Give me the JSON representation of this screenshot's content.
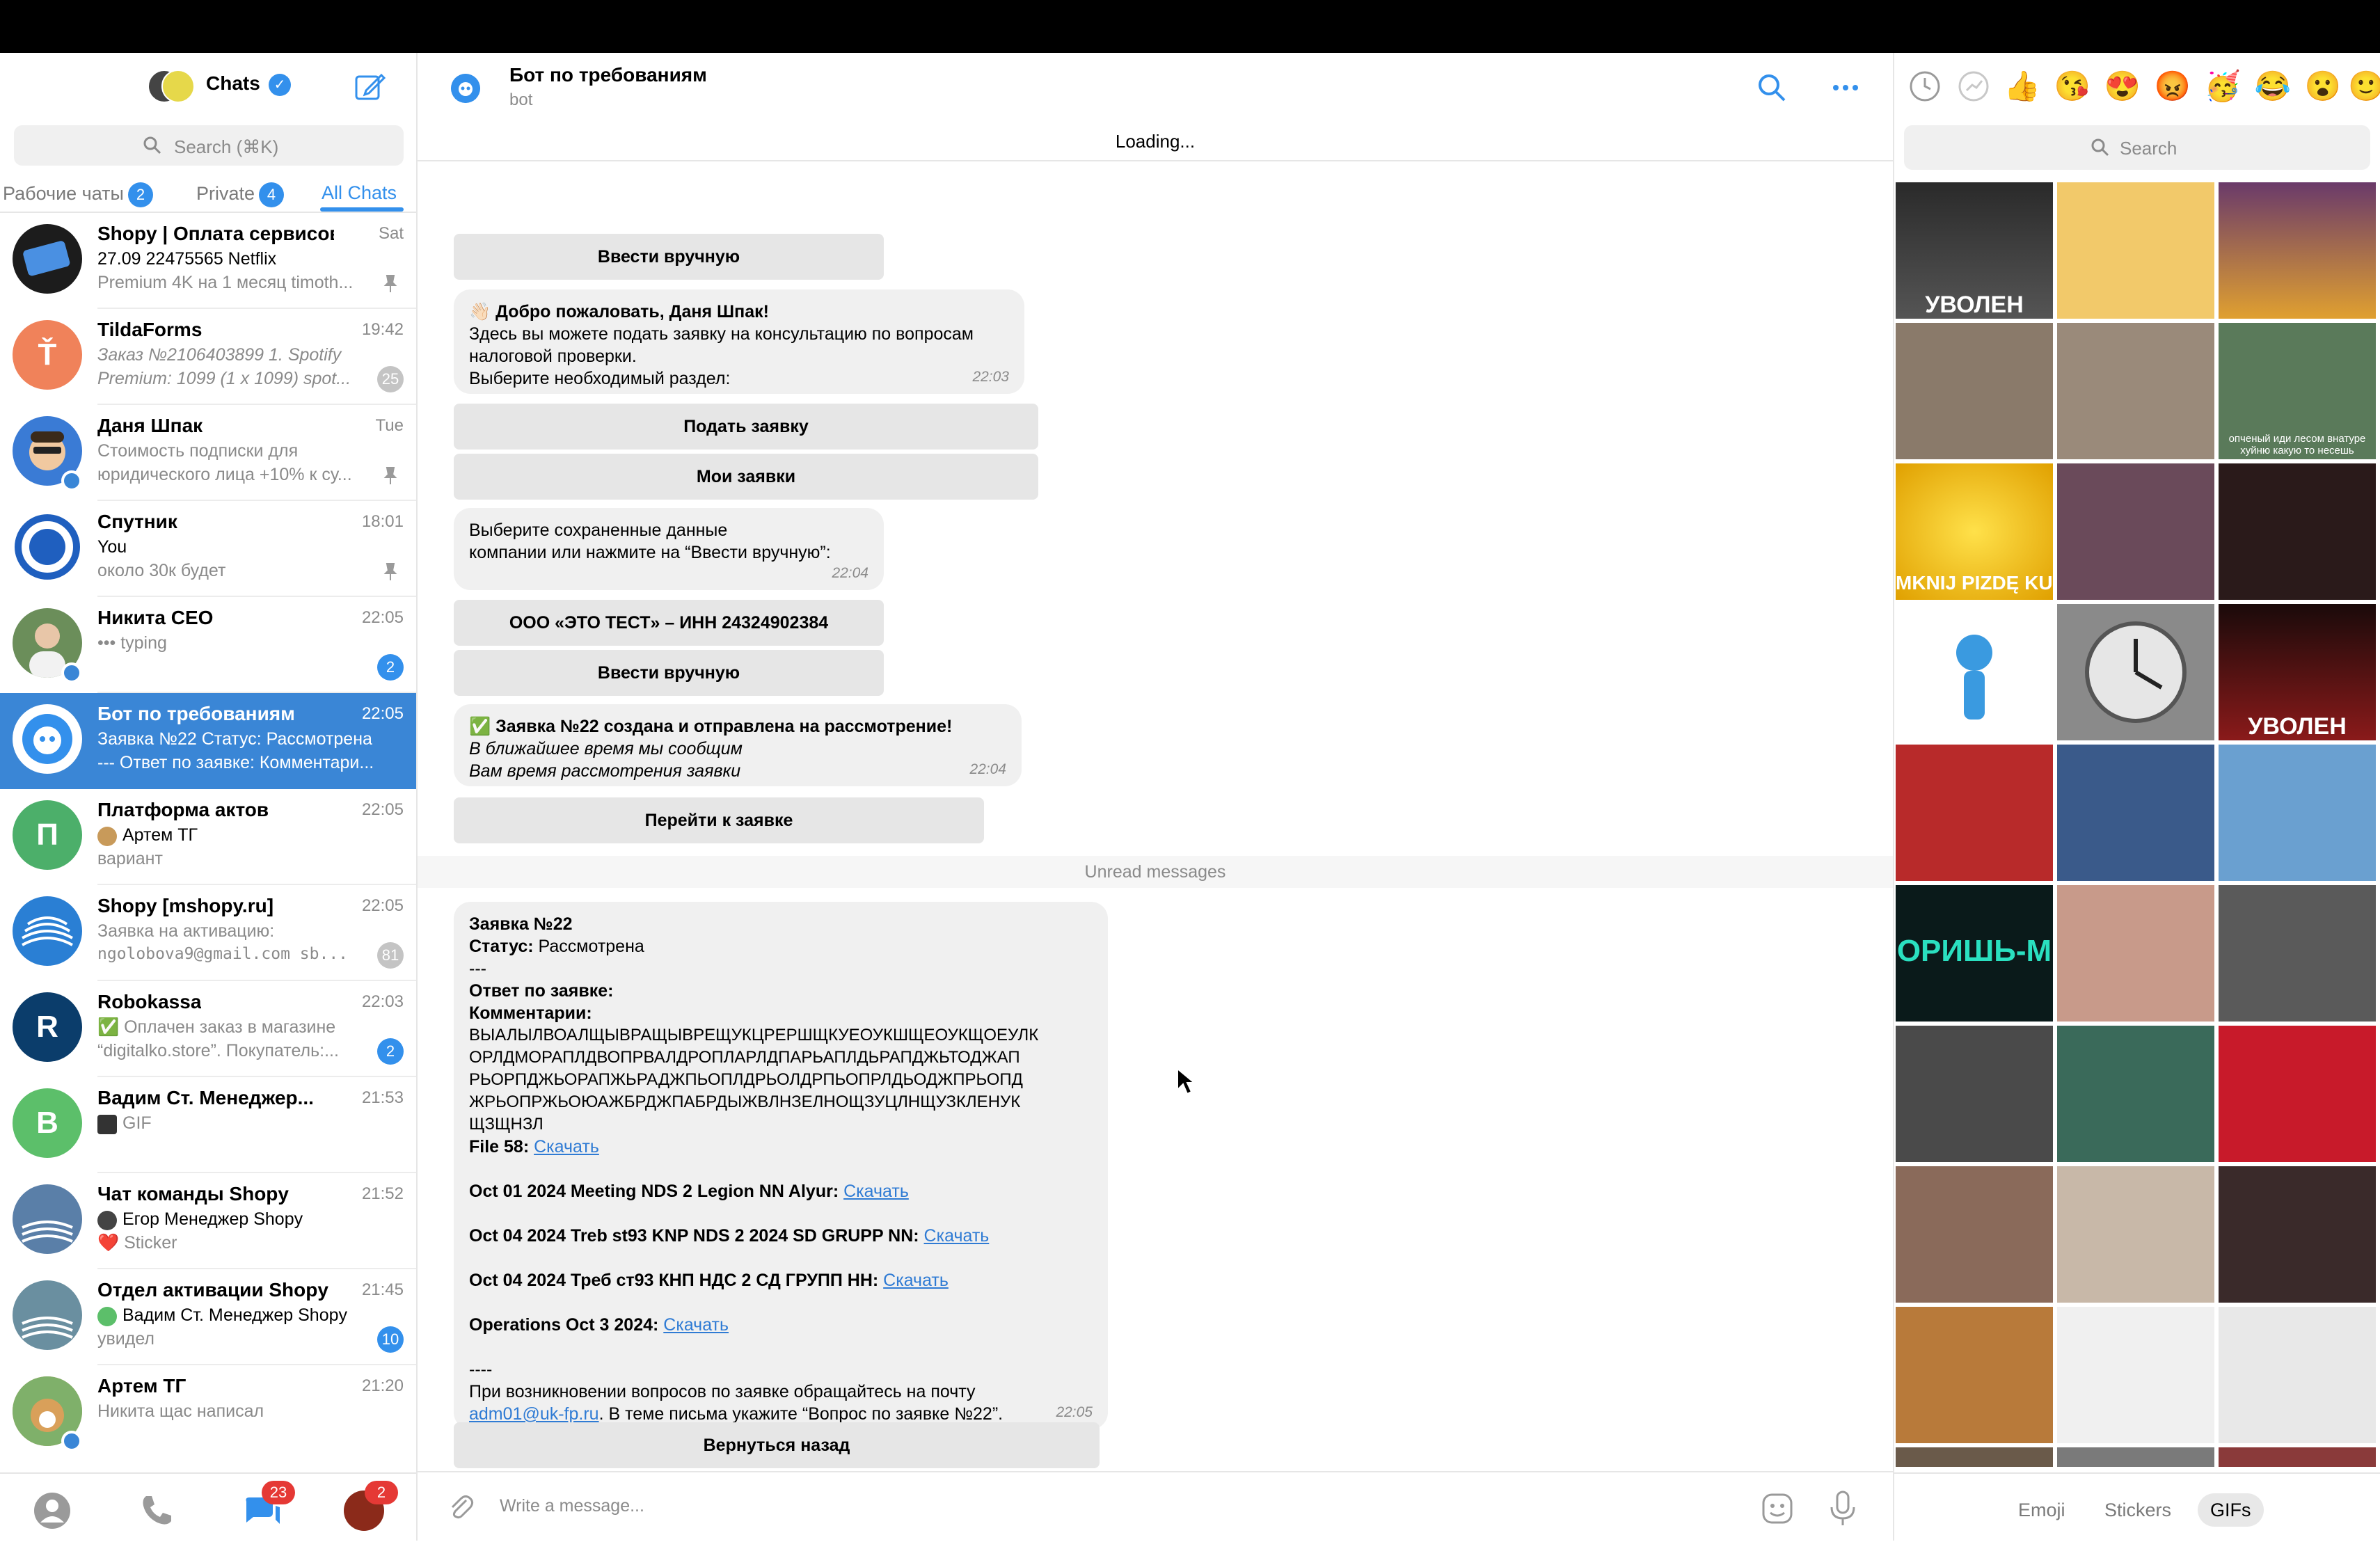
{
  "left": {
    "title": "Chats",
    "search_placeholder": "Search (⌘K)",
    "folders": [
      {
        "label": "Рабочие чаты",
        "badge": "2"
      },
      {
        "label": "Private",
        "badge": "4"
      },
      {
        "label": "All Chats",
        "badge": ""
      }
    ],
    "chats": [
      {
        "name": "Shopy | Оплата сервисов",
        "time": "Sat",
        "l1": "27.09 22475565  Netflix",
        "l2": "Premium 4K на 1 месяц timoth...",
        "count": "",
        "color": "#4a90e2"
      },
      {
        "name": "TildaForms",
        "time": "19:42",
        "l1": "Заказ №2106403899 1. Spotify",
        "l2": "Premium: 1099 (1 x 1099) spot...",
        "count": "25",
        "color": "#f0825a"
      },
      {
        "name": "Даня Шпак",
        "time": "Tue",
        "l1": "Стоимость подписки для",
        "l2": "юридического лица +10% к су...",
        "count": "",
        "color": "#3a7bd5"
      },
      {
        "name": "Спутник",
        "time": "18:01",
        "l1": "You",
        "l2": "около 30к будет",
        "count": "",
        "color": "#1f5fbf"
      },
      {
        "name": "Никита CEO",
        "time": "22:05",
        "l1": "••• typing",
        "l2": "",
        "count": "2",
        "color": "#6b8e5a"
      },
      {
        "name": "Бот по требованиям",
        "time": "22:05",
        "l1": "Заявка №22 Статус: Рассмотрена",
        "l2": "--- Ответ по заявке: Комментари...",
        "count": "",
        "color": "#ffffff"
      },
      {
        "name": "Платформа актов",
        "time": "22:05",
        "l1": "Артем ТГ",
        "l2": "вариант",
        "count": "",
        "color": "#4caf6a",
        "letter": "П"
      },
      {
        "name": "Shopy [mshopy.ru]",
        "time": "22:05",
        "l1": "Заявка на активацию:",
        "l2": "ngolobova9@gmail.com sb...",
        "count": "81",
        "color": "#2a7fd4"
      },
      {
        "name": "Robokassa",
        "time": "22:03",
        "l1": "✅ Оплачен заказ в магазине",
        "l2": "“digitalko.store”. Покупатель:...",
        "count": "2",
        "color": "#0b3d6b",
        "letter": "R"
      },
      {
        "name": "Вадим Ст. Менеджер...",
        "time": "21:53",
        "l1": "GIF",
        "l2": "",
        "count": "",
        "color": "#5cbf6a",
        "letter": "В"
      },
      {
        "name": "Чат команды Shopy",
        "time": "21:52",
        "l1": "Егор Менеджер Shopy",
        "l2": "❤️ Sticker",
        "count": "",
        "color": "#5a7fa8"
      },
      {
        "name": "Отдел активации Shopy",
        "time": "21:45",
        "l1": "Вадим Ст. Менеджер Shopy",
        "l2": "увидел",
        "count": "10",
        "color": "#6a8fa0"
      },
      {
        "name": "Артем ТГ",
        "time": "21:20",
        "l1": "Никита щас написал",
        "l2": "",
        "count": "",
        "color": "#c89a5a"
      }
    ],
    "nav": {
      "chats_badge": "23",
      "profile_badge": "2"
    }
  },
  "center": {
    "header": {
      "name": "Бот по требованиям",
      "sub": "bot"
    },
    "loading": "Loading...",
    "btn_manual_1": "Ввести вручную",
    "welcome": {
      "title": "👋🏻 Добро пожаловать, Даня Шпак!",
      "line1": "Здесь вы можете подать заявку на консультацию по вопросам",
      "line2": "налоговой проверки.",
      "line3": "Выберите необходимый раздел:",
      "time": "22:03"
    },
    "btn_submit": "Подать заявку",
    "btn_my": "Мои заявки",
    "choose": {
      "line1": "Выберите сохраненные данные",
      "line2": "компании или нажмите на “Ввести вручную”:",
      "time": "22:04"
    },
    "btn_company": "ООО «ЭТО ТЕСТ» – ИНН 24324902384",
    "btn_manual_2": "Ввести вручную",
    "created": {
      "title": "✅ Заявка №22 создана и отправлена на рассмотрение!",
      "line1": "В ближайшее время мы сообщим",
      "line2": "Вам время рассмотрения заявки",
      "time": "22:04"
    },
    "btn_goto": "Перейти к заявке",
    "unread": "Unread messages",
    "status": {
      "title": "Заявка №22",
      "status_label": "Статус:",
      "status_value": " Рассмотрена",
      "dashes": "---",
      "answer": "Ответ по заявке:",
      "comments": "Комментарии:",
      "gib1": "ВЫАЛЫЛВОАЛЩЫВРАЩЫВРЕЩУКЦРЕРШЩКУЕОУКШЩЕОУКЩОЕУЛК",
      "gib2": "ОРЛДМОРАПЛДВОПРВАЛДРОПЛАРЛДПАРЬАПЛДЬРАПДЖЬТОДЖАП",
      "gib3": "РЬОРПДЖЬОРАПЖЬРАДЖПЬОПЛДРЬОЛДРПЬОПРЛДЬОДЖПРЬОПД",
      "gib4": "ЖРЬОПРЖЬОЮАЖБРДЖПАБРДЫЖВЛНЗЕЛНОЩЗУЦЛНЩУЗКЛЕНУК",
      "gib5": "ЩЗЩНЗЛ",
      "file58": "File 58:",
      "download": "Скачать",
      "doc1": "Oct 01 2024 Meeting NDS 2 Legion NN Alyur:",
      "doc2": "Oct 04 2024 Treb st93 KNP NDS 2 2024 SD GRUPP NN:",
      "doc3": "Oct 04 2024 Треб ст93 КНП НДС 2 СД ГРУПП НН:",
      "doc4": "Operations Oct 3 2024:",
      "dashes2": "----",
      "footer1": "При возникновении вопросов по заявке обращайтесь на почту",
      "email": "adm01@uk-fp.ru",
      "footer2": ". В теме письма укажите “Вопрос по заявке №22”.",
      "time": "22:05"
    },
    "btn_back": "Вернуться назад",
    "composer_placeholder": "Write a message..."
  },
  "right": {
    "emojis": [
      "👍",
      "😘",
      "😍",
      "😡",
      "🥳",
      "😂",
      "😮",
      "🙂"
    ],
    "search_placeholder": "Search",
    "tabs": [
      "Emoji",
      "Stickers",
      "GIFs"
    ],
    "gif_captions": [
      "УВОЛЕН",
      "MKNIJ PIZDĘ KUR",
      "УВОЛЕН",
      "ОРИШЬ-М",
      "опченый иди лесом внатуре хуйню какую то несешь"
    ]
  },
  "colors": {
    "accent": "#3390ec",
    "active_chat": "#3a86d6",
    "badge_red": "#e53935"
  }
}
